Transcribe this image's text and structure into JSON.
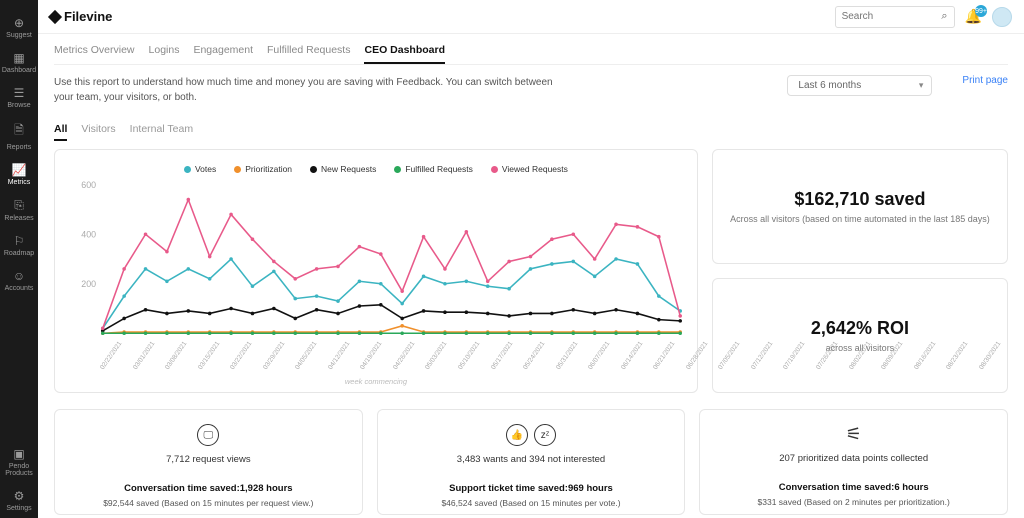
{
  "brand": "Filevine",
  "search": {
    "placeholder": "Search"
  },
  "notifications": {
    "count": "99+"
  },
  "sidebar": {
    "items": [
      {
        "label": "Suggest"
      },
      {
        "label": "Dashboard"
      },
      {
        "label": "Browse"
      },
      {
        "label": "Reports"
      },
      {
        "label": "Metrics"
      },
      {
        "label": "Releases"
      },
      {
        "label": "Roadmap"
      },
      {
        "label": "Accounts"
      }
    ],
    "bottom": [
      {
        "label": "Pendo Products"
      },
      {
        "label": "Settings"
      }
    ]
  },
  "tabs": [
    {
      "label": "Metrics Overview"
    },
    {
      "label": "Logins"
    },
    {
      "label": "Engagement"
    },
    {
      "label": "Fulfilled Requests"
    },
    {
      "label": "CEO Dashboard"
    }
  ],
  "description": "Use this report to understand how much time and money you are saving with Feedback. You can switch between your team, your visitors, or both.",
  "range": "Last 6 months",
  "print": "Print page",
  "filter_tabs": [
    {
      "label": "All"
    },
    {
      "label": "Visitors"
    },
    {
      "label": "Internal Team"
    }
  ],
  "legend": [
    {
      "label": "Votes",
      "color": "#3bb4c1"
    },
    {
      "label": "Prioritization",
      "color": "#f0902c"
    },
    {
      "label": "New Requests",
      "color": "#111111"
    },
    {
      "label": "Fulfilled Requests",
      "color": "#2aa85a"
    },
    {
      "label": "Viewed Requests",
      "color": "#e85a8a"
    }
  ],
  "x_axis_label": "week commencing",
  "stats": {
    "saved": {
      "big": "$162,710 saved",
      "sub": "Across all visitors (based on time automated in the last 185 days)"
    },
    "roi": {
      "big": "2,642% ROI",
      "sub": "across all visitors"
    }
  },
  "bottom_cards": [
    {
      "line1": "7,712 request views",
      "line2": "Conversation time saved:1,928 hours",
      "line3": "$92,544 saved (Based on 15 minutes per request view.)"
    },
    {
      "line1": "3,483 wants and 394 not interested",
      "line2": "Support ticket time saved:969 hours",
      "line3": "$46,524 saved (Based on 15 minutes per vote.)"
    },
    {
      "line1": "207 prioritized data points collected",
      "line2": "Conversation time saved:6 hours",
      "line3": "$331 saved (Based on 2 minutes per prioritization.)"
    }
  ],
  "chart_data": {
    "type": "line",
    "xlabel": "week commencing",
    "ylabel": "",
    "ylim": [
      0,
      600
    ],
    "yticks": [
      200,
      400,
      600
    ],
    "categories": [
      "02/22/2021",
      "03/01/2021",
      "03/08/2021",
      "03/15/2021",
      "03/22/2021",
      "03/29/2021",
      "04/05/2021",
      "04/12/2021",
      "04/19/2021",
      "04/26/2021",
      "05/03/2021",
      "05/10/2021",
      "05/17/2021",
      "05/24/2021",
      "05/31/2021",
      "06/07/2021",
      "06/14/2021",
      "06/21/2021",
      "06/28/2021",
      "07/05/2021",
      "07/12/2021",
      "07/19/2021",
      "07/26/2021",
      "08/02/2021",
      "08/09/2021",
      "08/16/2021",
      "08/23/2021",
      "08/30/2021"
    ],
    "series": [
      {
        "name": "Votes",
        "color": "#3bb4c1",
        "values": [
          20,
          150,
          260,
          210,
          260,
          220,
          300,
          190,
          250,
          140,
          150,
          130,
          210,
          200,
          120,
          230,
          200,
          210,
          190,
          180,
          260,
          280,
          290,
          230,
          300,
          280,
          150,
          90
        ]
      },
      {
        "name": "Prioritization",
        "color": "#f0902c",
        "values": [
          0,
          5,
          5,
          5,
          5,
          5,
          5,
          5,
          5,
          5,
          5,
          5,
          5,
          5,
          30,
          5,
          5,
          5,
          5,
          5,
          5,
          5,
          5,
          5,
          5,
          5,
          5,
          5
        ]
      },
      {
        "name": "New Requests",
        "color": "#111111",
        "values": [
          10,
          60,
          95,
          80,
          90,
          80,
          100,
          80,
          100,
          60,
          95,
          80,
          110,
          115,
          60,
          90,
          85,
          85,
          80,
          70,
          80,
          80,
          95,
          80,
          95,
          80,
          55,
          50
        ]
      },
      {
        "name": "Fulfilled Requests",
        "color": "#2aa85a",
        "values": [
          0,
          0,
          0,
          0,
          0,
          0,
          0,
          0,
          0,
          0,
          0,
          0,
          0,
          0,
          0,
          0,
          0,
          0,
          0,
          0,
          0,
          0,
          0,
          0,
          0,
          0,
          0,
          0
        ]
      },
      {
        "name": "Viewed Requests",
        "color": "#e85a8a",
        "values": [
          20,
          260,
          400,
          330,
          540,
          310,
          480,
          380,
          290,
          220,
          260,
          270,
          350,
          320,
          170,
          390,
          260,
          410,
          210,
          290,
          310,
          380,
          400,
          300,
          440,
          430,
          390,
          70
        ]
      }
    ]
  }
}
